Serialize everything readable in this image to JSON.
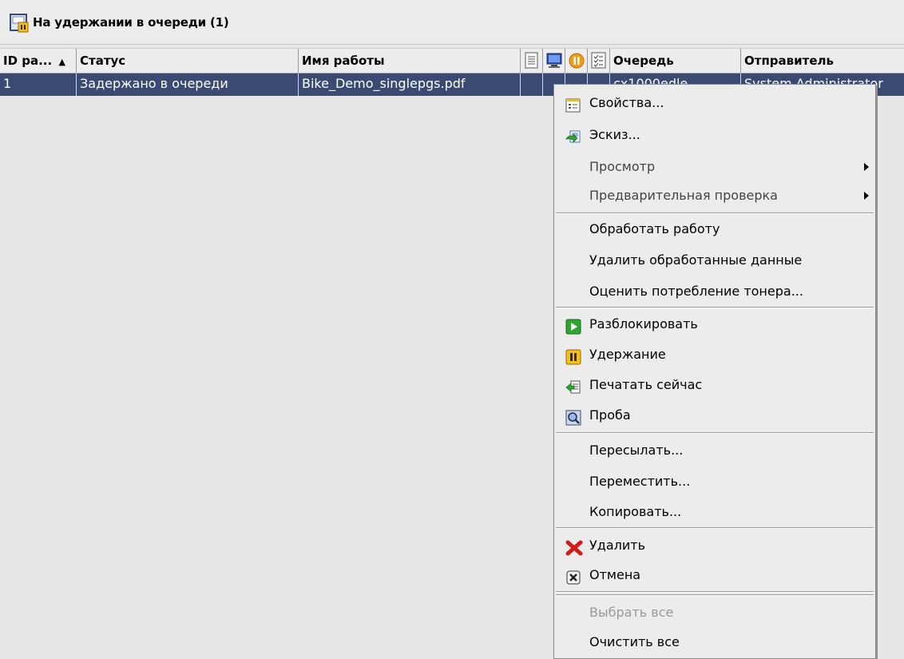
{
  "panel": {
    "title": "На удержании в очереди (1)"
  },
  "table": {
    "columns": [
      "ID ра...",
      "Статус",
      "Имя работы",
      "Очередь",
      "Отправитель"
    ],
    "rows": [
      {
        "id": "1",
        "status": "Задержано в очереди",
        "job_name": "Bike_Demo_singlepgs.pdf",
        "queue": "cx1000edle",
        "sender": "System Administrator"
      }
    ]
  },
  "context_menu": {
    "items": [
      {
        "label": "Свойства...",
        "icon": "properties-icon"
      },
      {
        "label": "Эскиз...",
        "icon": "thumbnail-icon"
      },
      {
        "label": "Просмотр",
        "submenu": true
      },
      {
        "label": "Предварительная проверка",
        "submenu": true
      },
      {
        "label": "Обработать работу"
      },
      {
        "label": "Удалить обработанные данные"
      },
      {
        "label": "Оценить потребление тонера..."
      },
      {
        "label": "Разблокировать",
        "icon": "play-icon"
      },
      {
        "label": "Удержание",
        "icon": "pause-icon"
      },
      {
        "label": "Печатать сейчас",
        "icon": "print-now-icon"
      },
      {
        "label": "Проба",
        "icon": "proof-icon"
      },
      {
        "label": "Пересылать..."
      },
      {
        "label": "Переместить..."
      },
      {
        "label": "Копировать..."
      },
      {
        "label": "Удалить",
        "icon": "delete-icon"
      },
      {
        "label": "Отмена",
        "icon": "cancel-icon"
      },
      {
        "label": "Выбрать все",
        "disabled": true
      },
      {
        "label": "Очистить все"
      }
    ]
  },
  "colors": {
    "selected_row": "#3b4a72",
    "background": "#e6e6e6",
    "accent_yellow": "#f1c01c",
    "accent_green": "#2fa52f",
    "delete_red": "#d11a1a"
  }
}
